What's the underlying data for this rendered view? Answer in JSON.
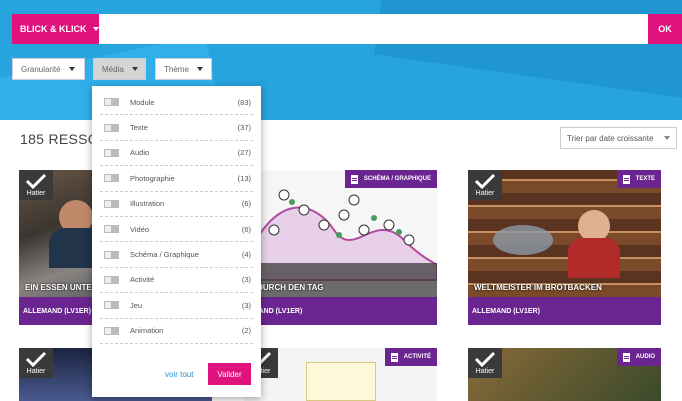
{
  "header": {
    "brand_button": "BLICK & KLICK",
    "ok_button": "OK",
    "search_placeholder": ""
  },
  "filters": {
    "granularite": "Granularité",
    "media": "Média",
    "theme": "Thème"
  },
  "results": {
    "count_text": "185 RESSO",
    "sort_label": "Trier par date croissante"
  },
  "dropdown": {
    "options": [
      {
        "label": "Module",
        "count": "(83)"
      },
      {
        "label": "Texte",
        "count": "(37)"
      },
      {
        "label": "Audio",
        "count": "(27)"
      },
      {
        "label": "Photographie",
        "count": "(13)"
      },
      {
        "label": "Illustration",
        "count": "(6)"
      },
      {
        "label": "Vidéo",
        "count": "(6)"
      },
      {
        "label": "Schéma / Graphique",
        "count": "(4)"
      },
      {
        "label": "Activité",
        "count": "(3)"
      },
      {
        "label": "Jeu",
        "count": "(3)"
      },
      {
        "label": "Animation",
        "count": "(2)"
      }
    ],
    "voir_tout": "voir tout",
    "valider": "Valider"
  },
  "cards": [
    {
      "title": "EIN ESSEN UNTER",
      "subject": "ALLEMAND (LV1ER)",
      "publisher": "Hatier"
    },
    {
      "title": "T DURCH DEN TAG",
      "subject": "EMAND (LV1ER)",
      "publisher": "Hatier",
      "tag": "SCHÉMA / GRAPHIQUE"
    },
    {
      "title": "WELTMEISTER IM BROTBACKEN",
      "subject": "ALLEMAND (LV1ER)",
      "publisher": "Hatier",
      "tag": "TEXTE"
    },
    {
      "publisher": "Hatier"
    },
    {
      "publisher": "Hatier",
      "tag": "ACTIVITÉ"
    },
    {
      "publisher": "Hatier",
      "tag": "AUDIO"
    }
  ],
  "colors": {
    "brand_pink": "#e0127d",
    "purple": "#6b2590",
    "hero_blue": "#27a3dd"
  }
}
